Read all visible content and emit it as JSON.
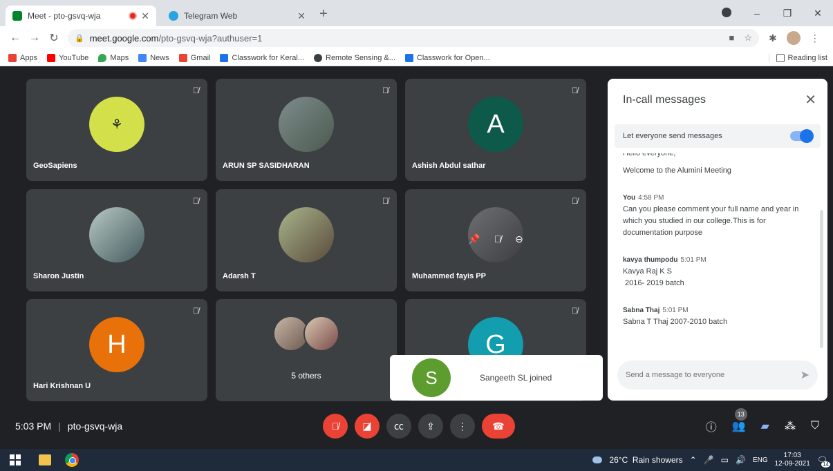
{
  "browser": {
    "tabs": [
      {
        "title": "Meet - pto-gsvq-wja",
        "favicon_color": "#00832d",
        "recording": true
      },
      {
        "title": "Telegram Web",
        "favicon_color": "#2aa3e1",
        "recording": false
      }
    ],
    "url_domain": "meet.google.com",
    "url_path": "/pto-gsvq-wja?authuser=1",
    "bookmarks": [
      {
        "label": "Apps",
        "color": "#e94235"
      },
      {
        "label": "YouTube",
        "color": "#ff0000"
      },
      {
        "label": "Maps",
        "color": "#34a853"
      },
      {
        "label": "News",
        "color": "#4285f4"
      },
      {
        "label": "Gmail",
        "color": "#ea4335"
      },
      {
        "label": "Classwork for Keral...",
        "color": "#1a73e8"
      },
      {
        "label": "Remote Sensing &...",
        "color": "#3c4043"
      },
      {
        "label": "Classwork for Open...",
        "color": "#1a73e8"
      }
    ],
    "reading_list": "Reading list"
  },
  "participants": [
    {
      "name": "GeoSapiens",
      "avatar_color": "#d4e04a",
      "letter": ""
    },
    {
      "name": "ARUN SP SASIDHARAN",
      "avatar_color": "#6b7b6d",
      "letter": ""
    },
    {
      "name": "Ashish Abdul sathar",
      "avatar_color": "#0d5a4a",
      "letter": "A"
    },
    {
      "name": "Sharon Justin",
      "avatar_color": "#8aa0a5",
      "letter": ""
    },
    {
      "name": "Adarsh T",
      "avatar_color": "#7d8f6a",
      "letter": ""
    },
    {
      "name": "Muhammed fayis PP",
      "avatar_color": "#55585c",
      "letter": ""
    },
    {
      "name": "Hari Krishnan U",
      "avatar_color": "#e8710a",
      "letter": "H"
    },
    {
      "name": "5 others",
      "avatar_color": "#5f6368",
      "letter": ""
    },
    {
      "name": "",
      "avatar_color": "#129eaf",
      "letter": "G"
    }
  ],
  "toast": {
    "letter": "S",
    "text": "Sangeeth SL joined"
  },
  "chat": {
    "title": "In-call messages",
    "allow_label": "Let everyone send messages",
    "partial_text": "Hello everyone,",
    "welcome": "Welcome to the Alumini Meeting",
    "messages": [
      {
        "sender": "You",
        "time": "4:58 PM",
        "lines": [
          "Can you please comment your full name and year in which you studied in our college.This is for documentation purpose"
        ]
      },
      {
        "sender": "kavya thumpodu",
        "time": "5:01 PM",
        "lines": [
          "Kavya Raj K S",
          " 2016- 2019 batch"
        ]
      },
      {
        "sender": "Sabna Thaj",
        "time": "5:01 PM",
        "lines": [
          "Sabna T Thaj 2007-2010 batch"
        ]
      }
    ],
    "input_placeholder": "Send a message to everyone"
  },
  "meeting": {
    "time": "5:03 PM",
    "code": "pto-gsvq-wja",
    "participant_count": "13"
  },
  "taskbar": {
    "weather": "26°C  Rain showers",
    "lang": "ENG",
    "time": "17:03",
    "date": "12-09-2021",
    "notif_count": "14"
  }
}
